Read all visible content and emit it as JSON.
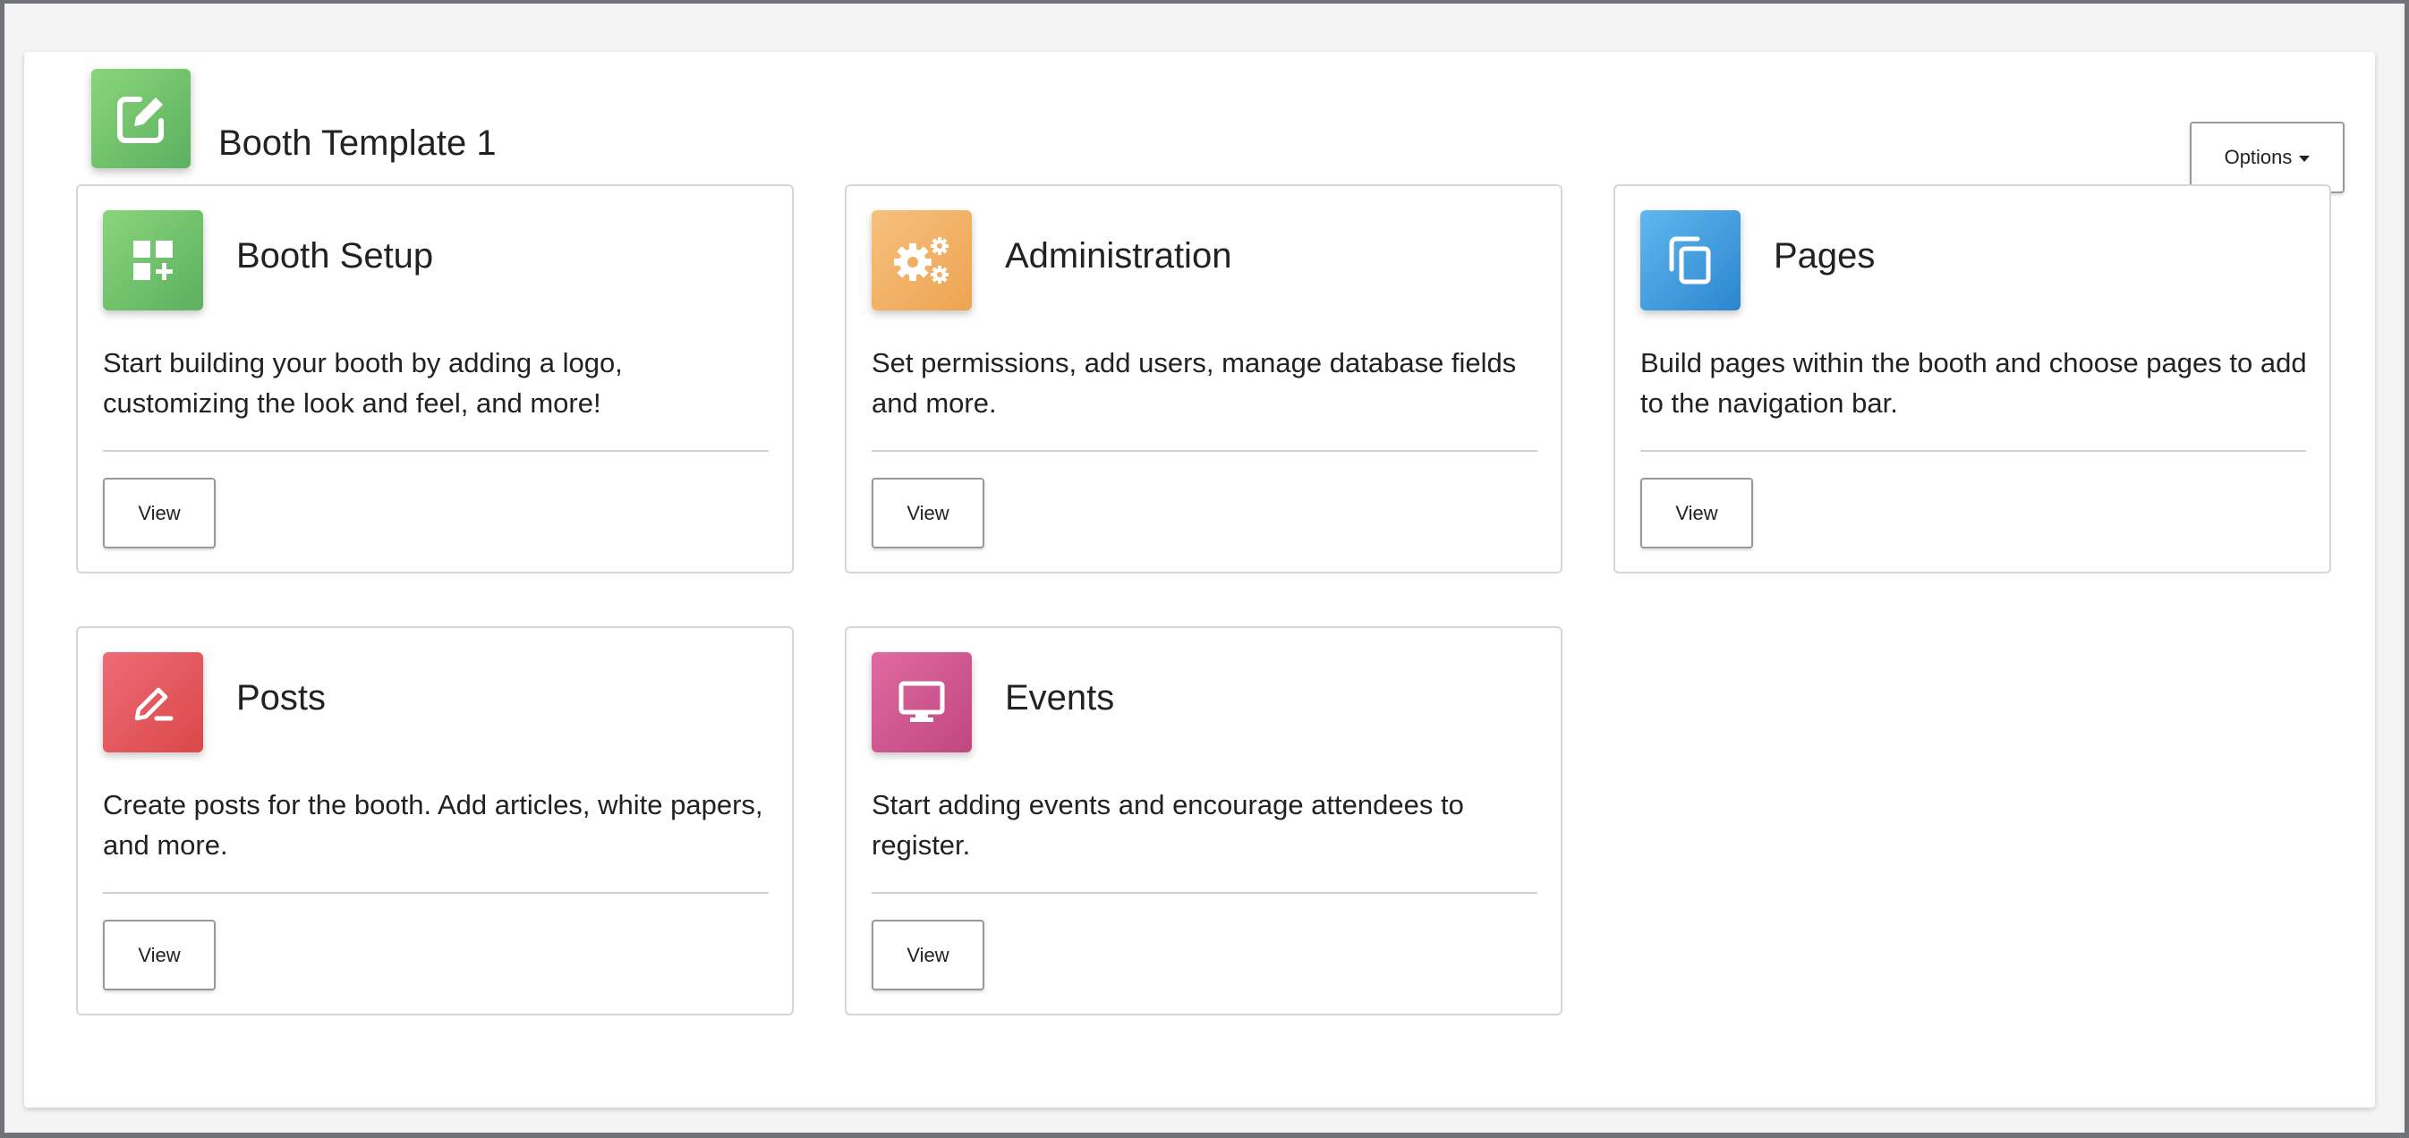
{
  "header": {
    "title": "Booth Template 1",
    "icon": "edit-icon",
    "icon_colors": [
      "#8ad57b",
      "#5bb05f"
    ],
    "options_label": "Options"
  },
  "tiles": [
    {
      "title": "Booth Setup",
      "description": "Start building your booth by adding a logo, customizing the look and feel, and more!",
      "icon": "dashboard-add-icon",
      "colors": [
        "#8ad57b",
        "#5bb05f"
      ],
      "button_label": "View"
    },
    {
      "title": "Administration",
      "description": "Set permissions, add users, manage database fields and more.",
      "icon": "gears-icon",
      "colors": [
        "#f6c07d",
        "#eda451"
      ],
      "button_label": "View"
    },
    {
      "title": "Pages",
      "description": "Build pages within the booth and choose pages to add to the navigation bar.",
      "icon": "copy-pages-icon",
      "colors": [
        "#5fb8ee",
        "#2c86cf"
      ],
      "button_label": "View"
    },
    {
      "title": "Posts",
      "description": "Create posts for the booth. Add articles, white papers, and more.",
      "icon": "pencil-icon",
      "colors": [
        "#ee6b77",
        "#d94848"
      ],
      "button_label": "View"
    },
    {
      "title": "Events",
      "description": "Start adding events and encourage attendees to register.",
      "icon": "monitor-icon",
      "colors": [
        "#e06aa0",
        "#c04680"
      ],
      "button_label": "View"
    }
  ]
}
